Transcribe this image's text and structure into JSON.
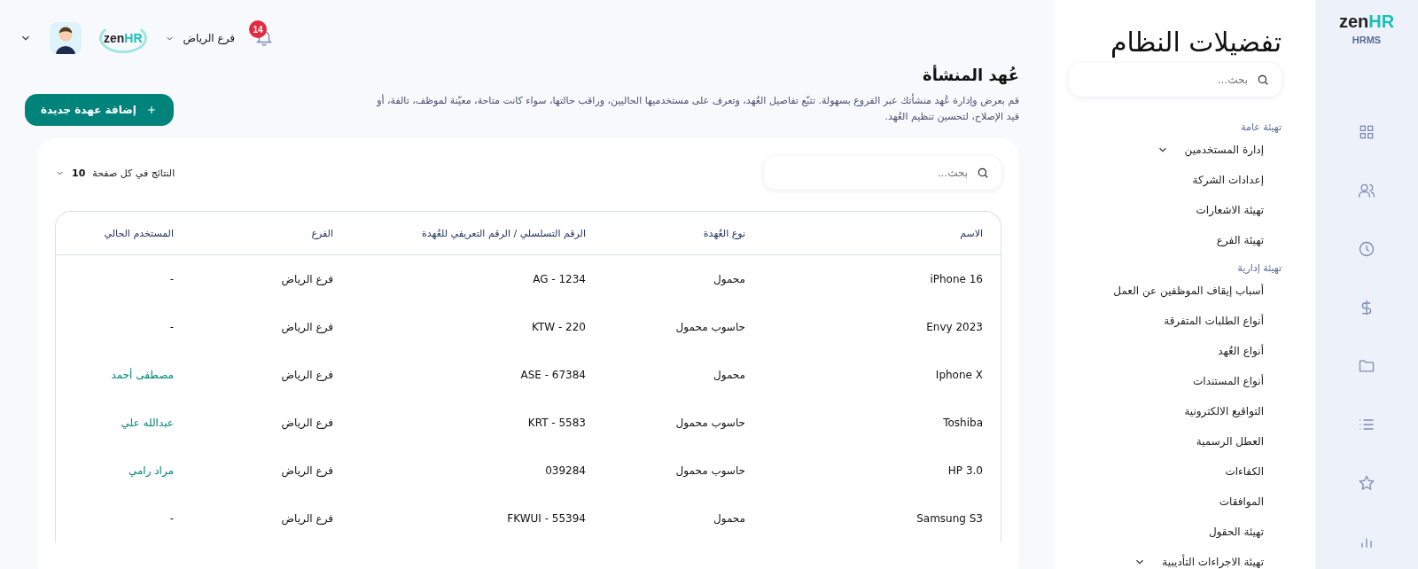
{
  "header": {
    "notification_count": "14",
    "branch": "فرع الرياض",
    "logo": {
      "word": "zen",
      "accent": "HR"
    }
  },
  "page": {
    "title": "عُهد المنشأة",
    "description": "قم بعرض وإدارة عُهد منشأتك عبر الفروع بسهولة. تتبّع تفاصيل العُهد، وتعرف على مستخدميها الحاليين، وراقب حالتها، سواء كانت متاحة، معيّنة لموظف، تالفة، أو قيد الإصلاح، لتحسين تنظيم العُهد.",
    "add_button": "إضافة عهدة جديدة"
  },
  "table_tools": {
    "search": {
      "placeholder": "بحث..."
    },
    "page_size": {
      "label": "النتائج في كل صفحة",
      "value": "10"
    }
  },
  "table": {
    "columns": [
      "الاسم",
      "نوع العُهدة",
      "الرقم التسلسلي / الرقم التعريفي للعُهدة",
      "الفرع",
      "المستخدم الحالي"
    ],
    "rows": [
      {
        "cells": [
          "iPhone 16",
          "محمول",
          "AG - 1234",
          "فرع الرياض",
          "-"
        ],
        "user_linked": false
      },
      {
        "cells": [
          "Envy 2023",
          "حاسوب محمول",
          "KTW - 220",
          "فرع الرياض",
          "-"
        ],
        "user_linked": false
      },
      {
        "cells": [
          "Iphone X",
          "محمول",
          "ASE - 67384",
          "فرع الرياض",
          "مصطفى أحمد"
        ],
        "user_linked": true
      },
      {
        "cells": [
          "Toshiba",
          "حاسوب محمول",
          "KRT - 5583",
          "فرع الرياض",
          "عبدالله علي"
        ],
        "user_linked": true
      },
      {
        "cells": [
          "HP 3.0",
          "حاسوب محمول",
          "039284",
          "فرع الرياض",
          "مراد رامي"
        ],
        "user_linked": true
      },
      {
        "cells": [
          "Samsung S3",
          "محمول",
          "FKWUI - 55394",
          "فرع الرياض",
          "-"
        ],
        "user_linked": false
      }
    ]
  },
  "settings_panel": {
    "title": "تفضيلات النظام",
    "search": {
      "placeholder": "بحث..."
    },
    "sections": [
      {
        "title": "تهيئة عامة",
        "items": [
          {
            "label": "إدارة المستخدمين",
            "kind": "dropdown"
          },
          {
            "label": "إعدادات الشركة",
            "kind": "link"
          },
          {
            "label": "تهيئة الاشعارات",
            "kind": "link"
          },
          {
            "label": "تهيئة الفرع",
            "kind": "link"
          }
        ]
      },
      {
        "title": "تهيئة إدارية",
        "items": [
          {
            "label": "أسباب إيقاف الموظفين عن العمل",
            "kind": "link"
          },
          {
            "label": "أنواع الطلبات المتفرقة",
            "kind": "link"
          },
          {
            "label": "أنواع العُهد",
            "kind": "link"
          },
          {
            "label": "أنواع المستندات",
            "kind": "link"
          },
          {
            "label": "التواقيع الالكترونية",
            "kind": "link"
          },
          {
            "label": "العطل الرسمية",
            "kind": "link"
          },
          {
            "label": "الكفاءات",
            "kind": "link"
          },
          {
            "label": "الموافقات",
            "kind": "link"
          },
          {
            "label": "تهيئة الحقول",
            "kind": "link"
          },
          {
            "label": "تهيئة الاجراءات التأديبية",
            "kind": "dropdown"
          }
        ]
      }
    ]
  },
  "rail": {
    "logo": {
      "word": "zen",
      "accent": "HR"
    },
    "product": "HRMS"
  }
}
